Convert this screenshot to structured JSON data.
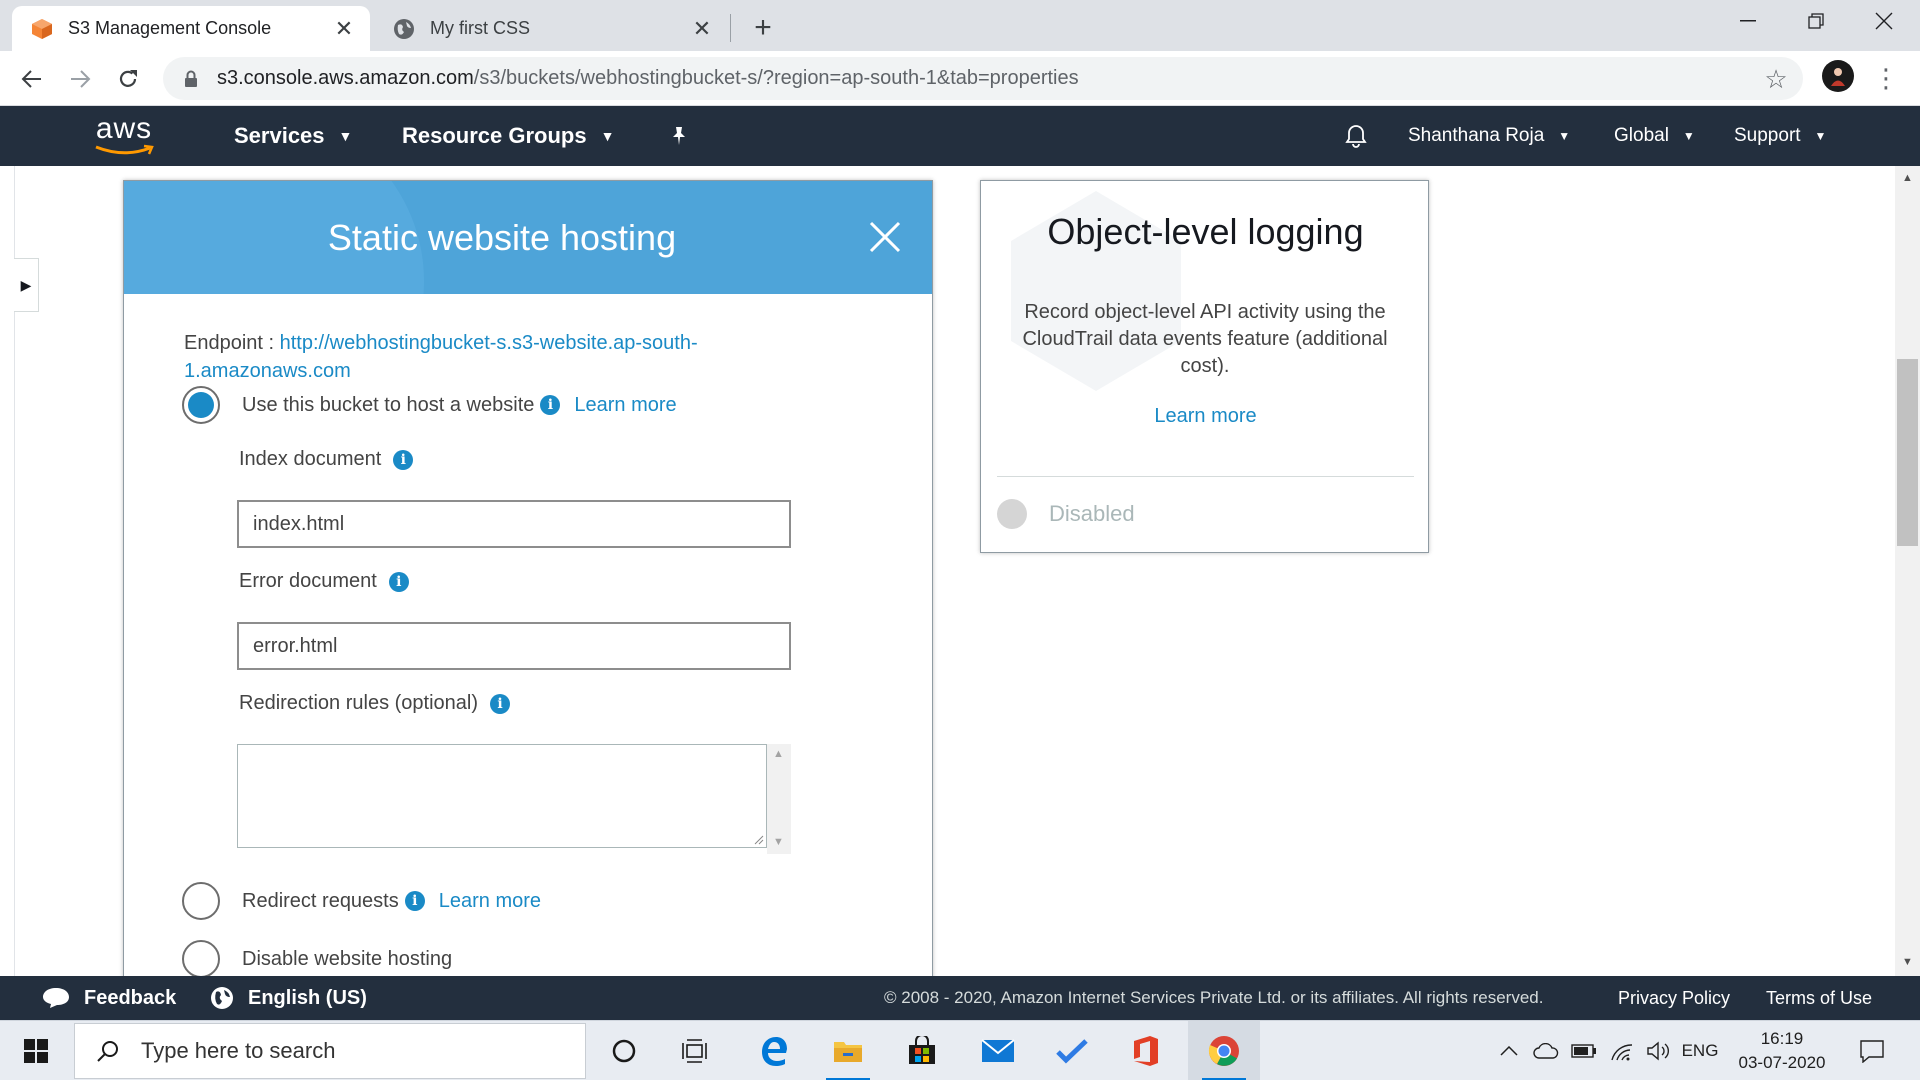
{
  "browser": {
    "tabs": [
      {
        "title": "S3 Management Console",
        "active": true
      },
      {
        "title": "My first CSS",
        "active": false
      }
    ],
    "url_host": "s3.console.aws.amazon.com",
    "url_path": "/s3/buckets/webhostingbucket-s/?region=ap-south-1&tab=properties"
  },
  "aws_nav": {
    "logo": "aws",
    "services": "Services",
    "resource_groups": "Resource Groups",
    "user": "Shanthana Roja",
    "region": "Global",
    "support": "Support"
  },
  "hosting_modal": {
    "title": "Static website hosting",
    "endpoint_label": "Endpoint : ",
    "endpoint_url": "http://webhostingbucket-s.s3-website.ap-south-1.amazonaws.com",
    "option_host": "Use this bucket to host a website",
    "learn_more": "Learn more",
    "index_label": "Index document",
    "index_value": "index.html",
    "error_label": "Error document",
    "error_value": "error.html",
    "redirection_label": "Redirection rules (optional)",
    "option_redirect": "Redirect requests",
    "option_disable": "Disable website hosting"
  },
  "logging_card": {
    "title": "Object-level logging",
    "description": "Record object-level API activity using the CloudTrail data events feature (additional cost).",
    "learn_more": "Learn more",
    "status": "Disabled"
  },
  "footer": {
    "feedback": "Feedback",
    "language": "English (US)",
    "copyright": "© 2008 - 2020, Amazon Internet Services Private Ltd. or its affiliates. All rights reserved.",
    "privacy": "Privacy Policy",
    "terms": "Terms of Use"
  },
  "taskbar": {
    "search_placeholder": "Type here to search",
    "language": "ENG",
    "time": "16:19",
    "date": "03-07-2020"
  },
  "colors": {
    "aws_nav": "#232f3e",
    "modal_header": "#4ea4d9",
    "link": "#1a8ac6",
    "aws_orange": "#ff9900"
  }
}
